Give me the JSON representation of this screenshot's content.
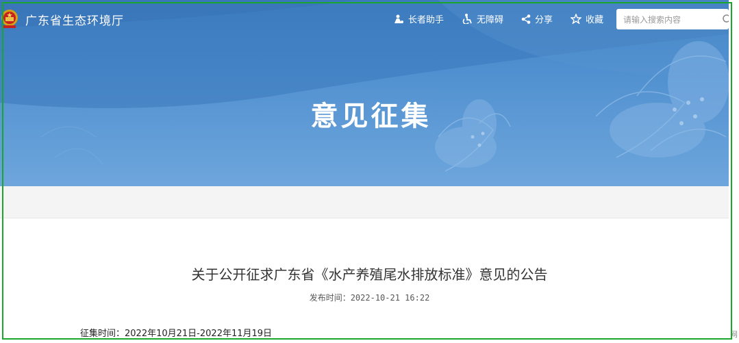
{
  "header": {
    "site_name": "广东省生态环境厅",
    "tools": [
      {
        "label": "长者助手",
        "icon": "elder-assist-icon"
      },
      {
        "label": "无障碍",
        "icon": "accessibility-icon"
      },
      {
        "label": "分享",
        "icon": "share-icon"
      },
      {
        "label": "收藏",
        "icon": "star-icon"
      }
    ],
    "search_placeholder": "请输入搜索内容"
  },
  "banner": {
    "title": "意见征集"
  },
  "article": {
    "title": "关于公开征求广东省《水产养殖尾水排放标准》意见的公告",
    "publish_label": "发布时间：",
    "publish_time": "2022-10-21 16:22",
    "collect_label": "征集时间：",
    "collect_period": "2022年10月21日-2022年11月19日"
  },
  "misc": {
    "corner_char": "网"
  },
  "colors": {
    "banner_top": "#3f7fc2",
    "banner_bottom": "#6ea6dc",
    "frame_border": "#1aa52c"
  }
}
